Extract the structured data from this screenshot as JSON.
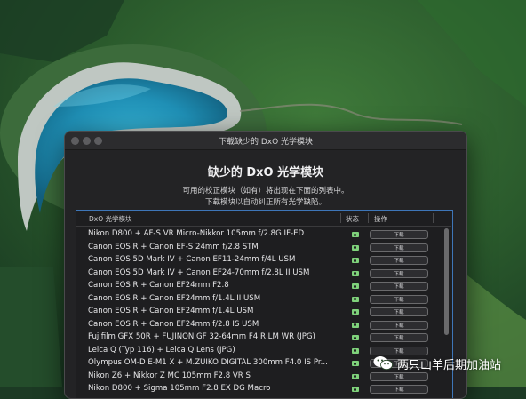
{
  "window": {
    "title": "下载缺少的 DxO 光学模块",
    "heading": "缺少的 DxO 光学模块",
    "subtitle_line1": "可用的校正模块（如有）将出现在下面的列表中。",
    "subtitle_line2": "下载模块以自动纠正所有光学缺陷。"
  },
  "table": {
    "headers": {
      "name": "DxO 光学模块",
      "status": "状态",
      "action": "操作"
    },
    "rows": [
      {
        "name": "Nikon D800 + AF-S VR Micro-Nikkor 105mm f/2.8G IF-ED",
        "action": "下载"
      },
      {
        "name": "Canon EOS R + Canon EF-S 24mm f/2.8 STM",
        "action": "下载"
      },
      {
        "name": "Canon EOS 5D Mark IV + Canon EF11-24mm f/4L USM",
        "action": "下载"
      },
      {
        "name": "Canon EOS 5D Mark IV + Canon EF24-70mm f/2.8L II USM",
        "action": "下载"
      },
      {
        "name": "Canon EOS R + Canon EF24mm F2.8",
        "action": "下载"
      },
      {
        "name": "Canon EOS R + Canon EF24mm f/1.4L II USM",
        "action": "下载"
      },
      {
        "name": "Canon EOS R + Canon EF24mm f/1.4L USM",
        "action": "下载"
      },
      {
        "name": "Canon EOS R + Canon EF24mm f/2.8 IS USM",
        "action": "下载"
      },
      {
        "name": "Fujifilm GFX 50R + FUJINON GF 32-64mm F4 R LM WR (JPG)",
        "action": "下载"
      },
      {
        "name": "Leica Q (Typ 116) + Leica Q Lens (JPG)",
        "action": "下载"
      },
      {
        "name": "Olympus OM-D E-M1 X + M.ZUIKO DIGITAL 300mm F4.0 IS Pr...",
        "action": "下载"
      },
      {
        "name": "Nikon Z6 + Nikkor Z MC 105mm F2.8 VR S",
        "action": "下载"
      },
      {
        "name": "Nikon D800 + Sigma 105mm F2.8 EX DG Macro",
        "action": "下载"
      }
    ]
  },
  "watermark": {
    "text": "两只山羊后期加油站"
  },
  "colors": {
    "accent": "#3e76b8",
    "status_ok": "#7fd27b",
    "dialog_bg": "#232325"
  }
}
